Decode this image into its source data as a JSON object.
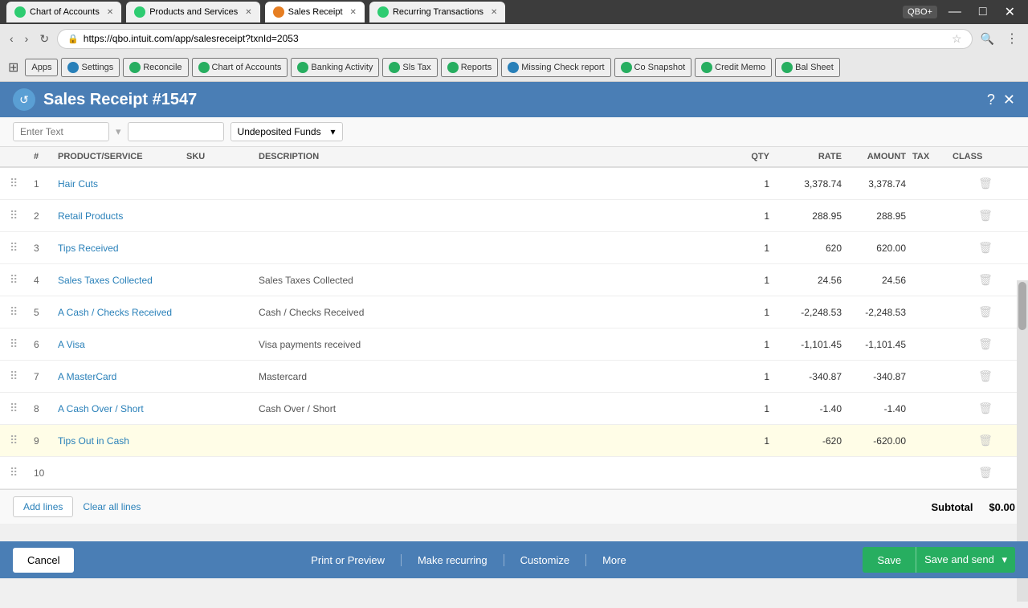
{
  "browser": {
    "tabs": [
      {
        "id": "chart",
        "label": "Chart of Accounts",
        "active": false,
        "icon": "green"
      },
      {
        "id": "products",
        "label": "Products and Services",
        "active": false,
        "icon": "green"
      },
      {
        "id": "sales",
        "label": "Sales Receipt",
        "active": true,
        "icon": "orange"
      },
      {
        "id": "recurring",
        "label": "Recurring Transactions",
        "active": false,
        "icon": "green"
      }
    ],
    "url": "https://qbo.intuit.com/app/salesreceipt?txnId=2053"
  },
  "toolbar": {
    "items": [
      {
        "id": "apps",
        "label": "Apps"
      },
      {
        "id": "settings",
        "label": "Settings"
      },
      {
        "id": "reconcile",
        "label": "Reconcile"
      },
      {
        "id": "chart",
        "label": "Chart of Accounts"
      },
      {
        "id": "banking",
        "label": "Banking Activity"
      },
      {
        "id": "slstax",
        "label": "Sls Tax"
      },
      {
        "id": "reports",
        "label": "Reports"
      },
      {
        "id": "missing",
        "label": "Missing Check report"
      },
      {
        "id": "cosnapshot",
        "label": "Co Snapshot"
      },
      {
        "id": "credit",
        "label": "Credit Memo"
      },
      {
        "id": "balsheet",
        "label": "Bal Sheet"
      }
    ]
  },
  "receipt": {
    "title": "Sales Receipt #1547",
    "deposit_to": "Undeposited Funds",
    "placeholder1": "Enter Text",
    "subtotal_label": "Subtotal",
    "subtotal_value": "$0.00"
  },
  "table": {
    "columns": [
      "",
      "#",
      "PRODUCT/SERVICE",
      "SKU",
      "DESCRIPTION",
      "QTY",
      "RATE",
      "AMOUNT",
      "TAX",
      "CLASS"
    ],
    "rows": [
      {
        "num": 1,
        "product": "Hair Cuts",
        "sku": "",
        "description": "",
        "qty": 1,
        "rate": "3,378.74",
        "amount": "3,378.74",
        "tax": "",
        "class": ""
      },
      {
        "num": 2,
        "product": "Retail Products",
        "sku": "",
        "description": "",
        "qty": 1,
        "rate": "288.95",
        "amount": "288.95",
        "tax": "",
        "class": ""
      },
      {
        "num": 3,
        "product": "Tips Received",
        "sku": "",
        "description": "",
        "qty": 1,
        "rate": "620",
        "amount": "620.00",
        "tax": "",
        "class": ""
      },
      {
        "num": 4,
        "product": "Sales Taxes Collected",
        "sku": "",
        "description": "Sales Taxes Collected",
        "qty": 1,
        "rate": "24.56",
        "amount": "24.56",
        "tax": "",
        "class": ""
      },
      {
        "num": 5,
        "product": "A Cash / Checks Received",
        "sku": "",
        "description": "Cash / Checks Received",
        "qty": 1,
        "rate": "-2,248.53",
        "amount": "-2,248.53",
        "tax": "",
        "class": ""
      },
      {
        "num": 6,
        "product": "A Visa",
        "sku": "",
        "description": "Visa payments received",
        "qty": 1,
        "rate": "-1,101.45",
        "amount": "-1,101.45",
        "tax": "",
        "class": ""
      },
      {
        "num": 7,
        "product": "A MasterCard",
        "sku": "",
        "description": "Mastercard",
        "qty": 1,
        "rate": "-340.87",
        "amount": "-340.87",
        "tax": "",
        "class": ""
      },
      {
        "num": 8,
        "product": "A Cash Over / Short",
        "sku": "",
        "description": "Cash Over / Short",
        "qty": 1,
        "rate": "-1.40",
        "amount": "-1.40",
        "tax": "",
        "class": ""
      },
      {
        "num": 9,
        "product": "Tips Out in Cash",
        "sku": "",
        "description": "",
        "qty": 1,
        "rate": "-620",
        "amount": "-620.00",
        "tax": "",
        "class": ""
      },
      {
        "num": 10,
        "product": "",
        "sku": "",
        "description": "",
        "qty": "",
        "rate": "",
        "amount": "",
        "tax": "",
        "class": ""
      }
    ]
  },
  "buttons": {
    "add_lines": "Add lines",
    "clear_all": "Clear all lines",
    "cancel": "Cancel",
    "print": "Print or Preview",
    "make_recurring": "Make recurring",
    "customize": "Customize",
    "more": "More",
    "save": "Save",
    "save_send": "Save and send"
  }
}
